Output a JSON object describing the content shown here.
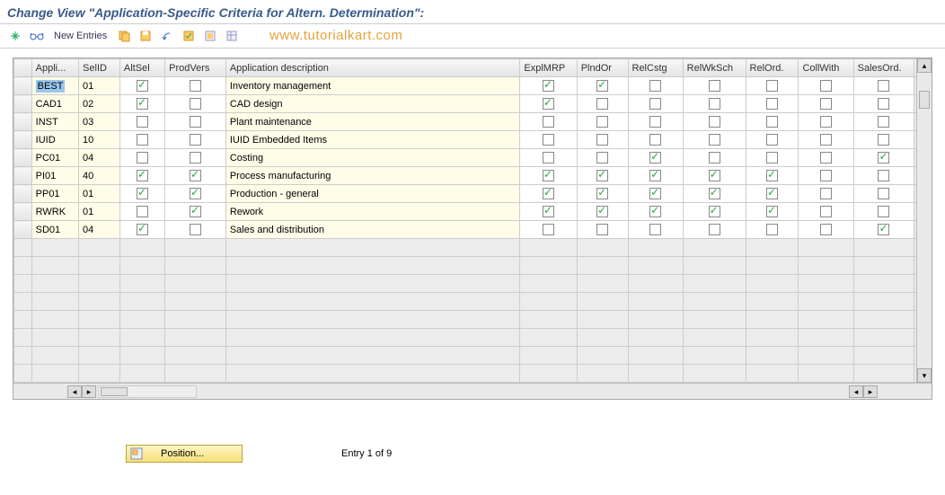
{
  "title": "Change View \"Application-Specific Criteria for Altern. Determination\":",
  "toolbar": {
    "new_entries": "New Entries"
  },
  "watermark": "www.tutorialkart.com",
  "columns": [
    "Appli...",
    "SelID",
    "AltSel",
    "ProdVers",
    "Application description",
    "ExplMRP",
    "PlndOr",
    "RelCstg",
    "RelWkSch",
    "RelOrd.",
    "CollWith",
    "SalesOrd."
  ],
  "rows": [
    {
      "app": "BEST",
      "selid": "01",
      "altsel": true,
      "prodvers": false,
      "desc": "Inventory management",
      "explmrp": true,
      "plndor": true,
      "relcstg": false,
      "relwksch": false,
      "relord": false,
      "collwith": false,
      "salesord": false
    },
    {
      "app": "CAD1",
      "selid": "02",
      "altsel": true,
      "prodvers": false,
      "desc": "CAD design",
      "explmrp": true,
      "plndor": false,
      "relcstg": false,
      "relwksch": false,
      "relord": false,
      "collwith": false,
      "salesord": false
    },
    {
      "app": "INST",
      "selid": "03",
      "altsel": false,
      "prodvers": false,
      "desc": "Plant maintenance",
      "explmrp": false,
      "plndor": false,
      "relcstg": false,
      "relwksch": false,
      "relord": false,
      "collwith": false,
      "salesord": false
    },
    {
      "app": "IUID",
      "selid": "10",
      "altsel": false,
      "prodvers": false,
      "desc": "IUID Embedded Items",
      "explmrp": false,
      "plndor": false,
      "relcstg": false,
      "relwksch": false,
      "relord": false,
      "collwith": false,
      "salesord": false
    },
    {
      "app": "PC01",
      "selid": "04",
      "altsel": false,
      "prodvers": false,
      "desc": "Costing",
      "explmrp": false,
      "plndor": false,
      "relcstg": true,
      "relwksch": false,
      "relord": false,
      "collwith": false,
      "salesord": true
    },
    {
      "app": "PI01",
      "selid": "40",
      "altsel": true,
      "prodvers": true,
      "desc": "Process manufacturing",
      "explmrp": true,
      "plndor": true,
      "relcstg": true,
      "relwksch": true,
      "relord": true,
      "collwith": false,
      "salesord": false
    },
    {
      "app": "PP01",
      "selid": "01",
      "altsel": true,
      "prodvers": true,
      "desc": "Production - general",
      "explmrp": true,
      "plndor": true,
      "relcstg": true,
      "relwksch": true,
      "relord": true,
      "collwith": false,
      "salesord": false
    },
    {
      "app": "RWRK",
      "selid": "01",
      "altsel": false,
      "prodvers": true,
      "desc": "Rework",
      "explmrp": true,
      "plndor": true,
      "relcstg": true,
      "relwksch": true,
      "relord": true,
      "collwith": false,
      "salesord": false
    },
    {
      "app": "SD01",
      "selid": "04",
      "altsel": true,
      "prodvers": false,
      "desc": "Sales and distribution",
      "explmrp": false,
      "plndor": false,
      "relcstg": false,
      "relwksch": false,
      "relord": false,
      "collwith": false,
      "salesord": true
    }
  ],
  "empty_rows": 8,
  "footer": {
    "position_label": "Position...",
    "entry_text": "Entry 1 of 9"
  }
}
